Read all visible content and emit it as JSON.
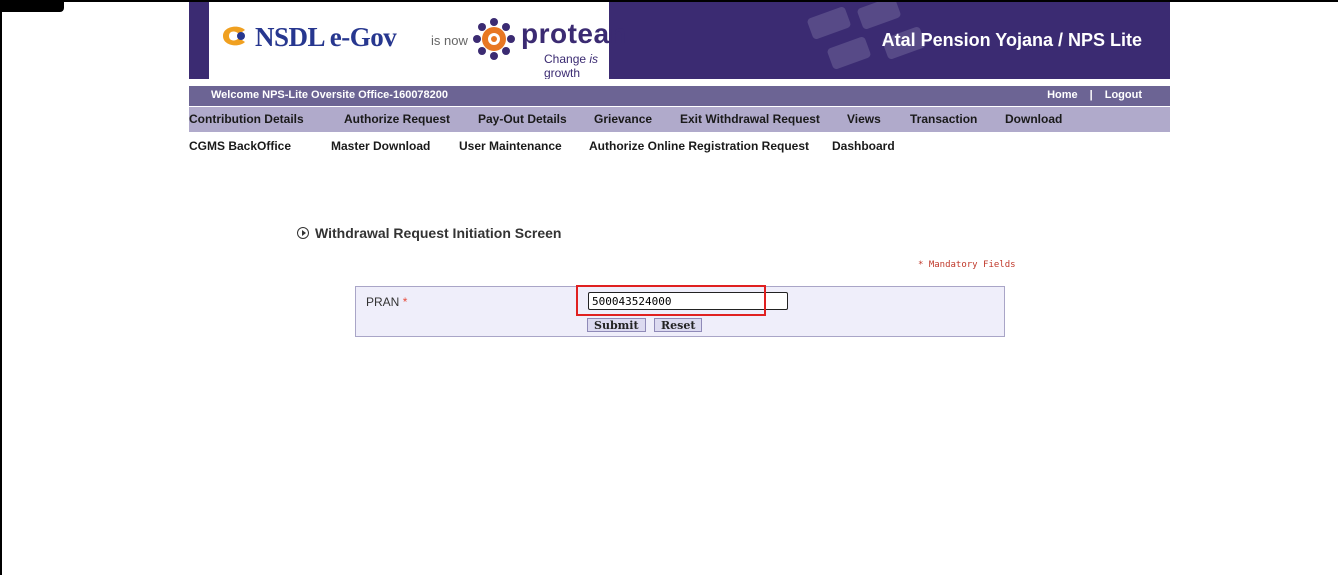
{
  "header": {
    "nsdl_brand_part1": "NSDL ",
    "nsdl_brand_part2": "e-Gov",
    "is_now": "is now",
    "protean_brand": "protean",
    "protean_tagline_1": "Change ",
    "protean_tagline_2": "is",
    "protean_tagline_3": " growth",
    "app_title": "Atal Pension Yojana / NPS Lite"
  },
  "welcome_bar": {
    "welcome": "Welcome NPS-Lite Oversite Office-160078200",
    "home": "Home",
    "separator": "|",
    "logout": "Logout"
  },
  "nav_primary": [
    "Contribution Details",
    "Authorize Request",
    "Pay-Out Details",
    "Grievance",
    "Exit Withdrawal Request",
    "Views",
    "Transaction",
    "Download"
  ],
  "nav_secondary": [
    "CGMS BackOffice",
    "Master Download",
    "User Maintenance",
    "Authorize Online Registration Request",
    "Dashboard"
  ],
  "page": {
    "title": "Withdrawal Request Initiation Screen",
    "mandatory_note": "* Mandatory Fields"
  },
  "form": {
    "pran_label": "PRAN",
    "required_marker": "*",
    "pran_value": "500043524000",
    "submit": "Submit",
    "reset": "Reset"
  },
  "colors": {
    "header_bg": "#3b2b72",
    "welcome_bar_bg": "#6c6494",
    "nav_bg": "#b0aacb",
    "form_bg": "#efeefa",
    "highlight": "#e02020"
  }
}
